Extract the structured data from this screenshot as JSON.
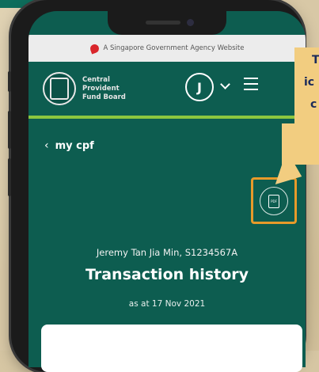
{
  "gov_banner": {
    "text": "A Singapore Government Agency Website"
  },
  "header": {
    "org_name_line1": "Central",
    "org_name_line2": "Provident",
    "org_name_line3": "Fund Board",
    "avatar_initial": "J"
  },
  "breadcrumb": {
    "label": "my cpf"
  },
  "profile": {
    "name_line": "Jeremy Tan Jia Min, S1234567A"
  },
  "page": {
    "title": "Transaction history",
    "as_at": "as at 17 Nov 2021"
  },
  "document_button": {
    "icon_label": "PDF"
  },
  "callout": {
    "text_line1": "T",
    "text_line2": "ic",
    "text_line3": "c"
  },
  "colors": {
    "brand_green": "#0d5d50",
    "accent_lime": "#8cc63f",
    "highlight_orange": "#e79a2a",
    "callout_bg": "#f2cd80"
  }
}
